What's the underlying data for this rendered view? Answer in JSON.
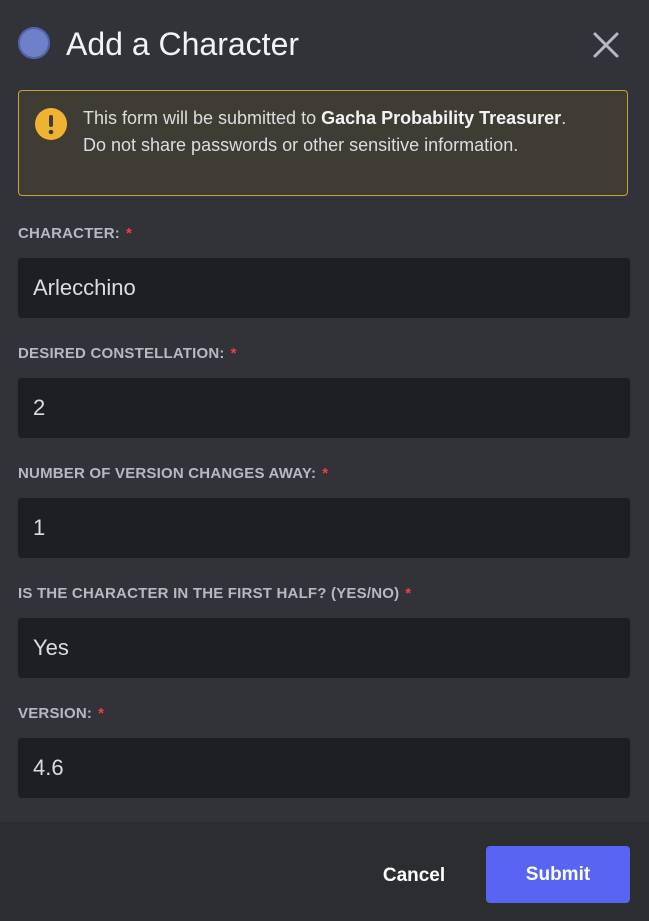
{
  "header": {
    "title": "Add a Character",
    "avatar_color": "#6e80c8",
    "close_icon": "close-icon"
  },
  "warning": {
    "icon": "warning-icon",
    "accent_color": "#f0b232",
    "text_prefix": "This form will be submitted to ",
    "app_name": "Gacha Probability Treasurer",
    "text_suffix": ". Do not share passwords or other sensitive information."
  },
  "fields": [
    {
      "label": "CHARACTER:",
      "required_mark": "*",
      "value": "Arlecchino"
    },
    {
      "label": "DESIRED CONSTELLATION:",
      "required_mark": "*",
      "value": "2"
    },
    {
      "label": "NUMBER OF VERSION CHANGES AWAY:",
      "required_mark": "*",
      "value": "1"
    },
    {
      "label": "IS THE CHARACTER IN THE FIRST HALF? (YES/NO)",
      "required_mark": "*",
      "value": "Yes"
    },
    {
      "label": "VERSION:",
      "required_mark": "*",
      "value": "4.6"
    }
  ],
  "footer": {
    "cancel_label": "Cancel",
    "submit_label": "Submit",
    "submit_color": "#5865f2"
  }
}
